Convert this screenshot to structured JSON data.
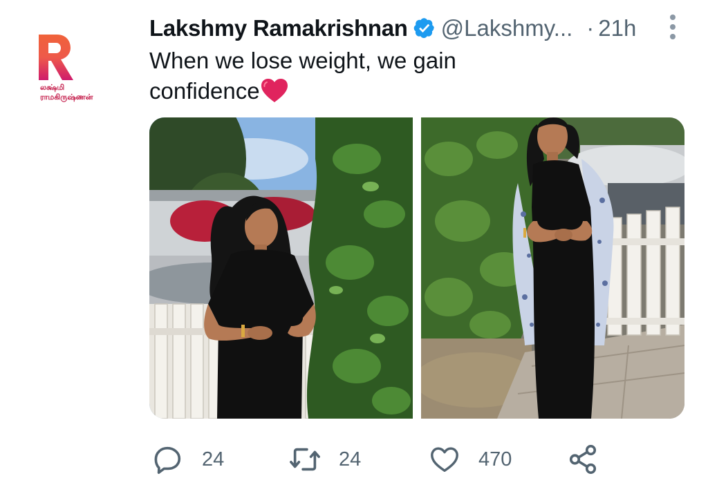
{
  "logo": {
    "line1": "லக்ஷ்மி",
    "line2": "ராமகிருஷ்ணன்",
    "colors": {
      "orange": "#f06b3c",
      "pink": "#d81b60"
    }
  },
  "tweet": {
    "display_name": "Lakshmy Ramakrishnan",
    "verified_icon": "verified-badge-icon",
    "handle": "@Lakshmy...",
    "separator": "·",
    "time": "21h",
    "text": "When we lose weight, we gain confidence",
    "emoji": "red-heart"
  },
  "media": {
    "photos": [
      {
        "name": "photo-1",
        "description_icon": "photo"
      },
      {
        "name": "photo-2",
        "description_icon": "photo"
      }
    ]
  },
  "actions": {
    "reply": {
      "icon": "reply-icon",
      "count": "24"
    },
    "retweet": {
      "icon": "retweet-icon",
      "count": "24"
    },
    "like": {
      "icon": "heart-icon",
      "count": "470"
    },
    "share": {
      "icon": "share-icon"
    }
  },
  "colors": {
    "verified": "#1d9bf0",
    "secondary": "#536471",
    "heart": "#e0245e"
  }
}
